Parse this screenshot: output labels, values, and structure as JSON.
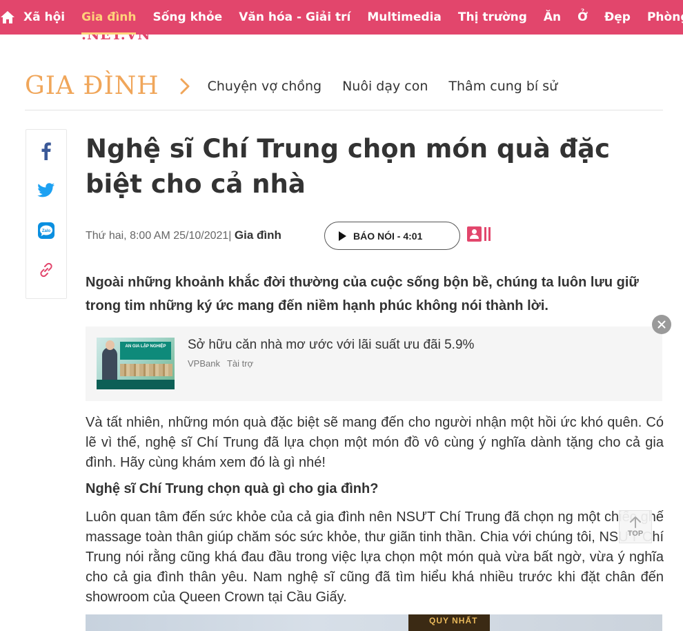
{
  "nav": {
    "home_icon": "home-icon",
    "items": [
      "Xã hội",
      "Gia đình",
      "Sống khỏe",
      "Văn hóa - Giải trí",
      "Multimedia",
      "Thị trường",
      "Ăn",
      "Ở",
      "Đẹp",
      "Phòng ..."
    ],
    "active_index": 1,
    "brand_color": "#e2466c",
    "active_color": "#ffd27a",
    "logo_fragment": ".NET.VN"
  },
  "category": {
    "title": "GIA ĐÌNH",
    "title_color": "#f0a65a",
    "chevron_icon": "chevron-right-icon",
    "subcategories": [
      "Chuyện vợ chồng",
      "Nuôi dạy con",
      "Thâm cung bí sử"
    ]
  },
  "share": {
    "icons": [
      "facebook-icon",
      "twitter-icon",
      "zalo-icon",
      "link-icon"
    ]
  },
  "article": {
    "headline": "Nghệ sĩ Chí Trung chọn món quà đặc biệt cho cả nhà",
    "meta_date": "Thứ hai, 8:00 AM 25/10/2021",
    "meta_sep": "|",
    "meta_category": "Gia đình",
    "audio_label": "BÁO NÓI - 4:01",
    "reader_icon": "reader-mode-icon",
    "sapo": "Ngoài những khoảnh khắc đời thường của cuộc sống bộn bề, chúng ta luôn lưu giữ trong tim những ký ức mang đến niềm hạnh phúc không nói thành lời.",
    "paragraph1": "Và tất nhiên, những món quà đặc biệt sẽ mang đến cho người nhận một hồi ức khó quên. Có lẽ vì thế, nghệ sĩ Chí Trung đã lựa chọn một món đồ vô cùng ý nghĩa dành tặng cho cả gia đình. Hãy cùng khám xem đó là gì nhé!",
    "subheading": "Nghệ sĩ Chí Trung chọn quà gì cho gia đình?",
    "paragraph2": "Luôn quan tâm đến sức khỏe của cả gia đình nên NSƯT Chí Trung đã chọn ng  một chiếc ghế massage toàn thân giúp chăm sóc sức khỏe, thư giãn tinh thần. Chia  với chúng tôi, NSƯT Chí Trung nói rằng cũng khá đau đầu trong việc lựa chọn một món quà vừa bất ngờ, vừa ý nghĩa cho cả gia đình thân yêu. Nam nghệ sĩ cũng đã tìm hiểu khá nhiều trước khi đặt chân đến showroom của Queen Crown tại Cầu Giấy.",
    "photo_sign_text": "QUY NHẤT"
  },
  "ad": {
    "image_text": "AN GIA LẬP NGHIỆP",
    "title": "Sở hữu căn nhà mơ ước với lãi suất ưu đãi 5.9%",
    "advertiser": "VPBank",
    "sponsored": "Tài trợ",
    "close_icon": "close-icon"
  },
  "back_to_top": {
    "label": "TOP",
    "icon": "arrow-up-icon"
  }
}
